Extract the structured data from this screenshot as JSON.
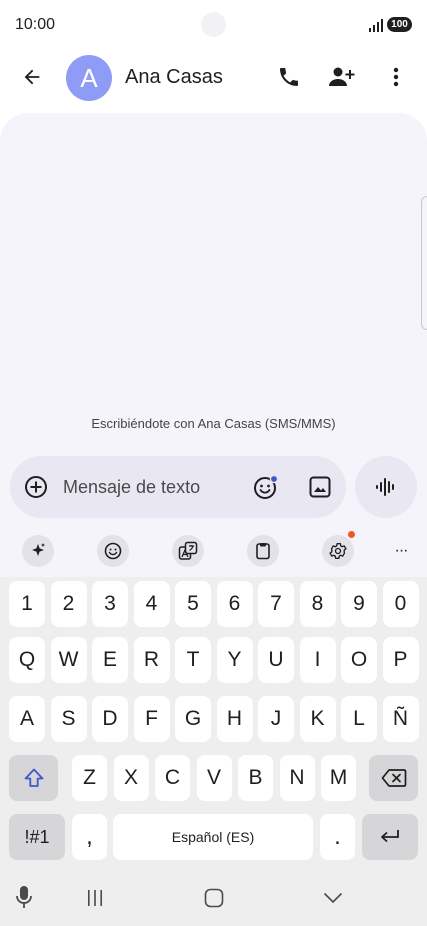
{
  "status_bar": {
    "time": "10:00",
    "battery": "100",
    "icons": [
      "signal-icon",
      "battery-icon"
    ]
  },
  "top_bar": {
    "avatar_letter": "A",
    "contact_name": "Ana Casas",
    "icons": [
      "back-arrow-icon",
      "phone-icon",
      "add-person-icon",
      "more-vert-icon"
    ]
  },
  "conversation": {
    "note": "Escribiéndote con Ana Casas (SMS/MMS)"
  },
  "compose": {
    "placeholder": "Mensaje de texto",
    "icons": [
      "add-circle-icon",
      "emoji-icon",
      "image-icon",
      "voice-wave-icon"
    ]
  },
  "keyboard_toolbar": {
    "icons": [
      "sparkle-icon",
      "emoji-icon",
      "translate-icon",
      "clipboard-icon",
      "settings-icon",
      "more-horiz-icon"
    ],
    "more_label": "···"
  },
  "keyboard": {
    "row_numbers": [
      "1",
      "2",
      "3",
      "4",
      "5",
      "6",
      "7",
      "8",
      "9",
      "0"
    ],
    "row_1": [
      "Q",
      "W",
      "E",
      "R",
      "T",
      "Y",
      "U",
      "I",
      "O",
      "P"
    ],
    "row_2": [
      "A",
      "S",
      "D",
      "F",
      "G",
      "H",
      "J",
      "K",
      "L",
      "Ñ"
    ],
    "row_3": [
      "Z",
      "X",
      "C",
      "V",
      "B",
      "N",
      "M"
    ],
    "symbols_label": "!#1",
    "comma_label": ",",
    "space_label": "Español (ES)",
    "period_label": ".",
    "icons": [
      "shift-icon",
      "backspace-icon",
      "enter-icon"
    ]
  },
  "nav_bar": {
    "icons": [
      "mic-icon",
      "recent-apps-icon",
      "home-icon",
      "hide-keyboard-icon"
    ]
  },
  "colors": {
    "avatar": "#8e9cf6",
    "badge": "#f05a22",
    "surface": "#f6f4fb",
    "compose": "#e9e7f1"
  }
}
